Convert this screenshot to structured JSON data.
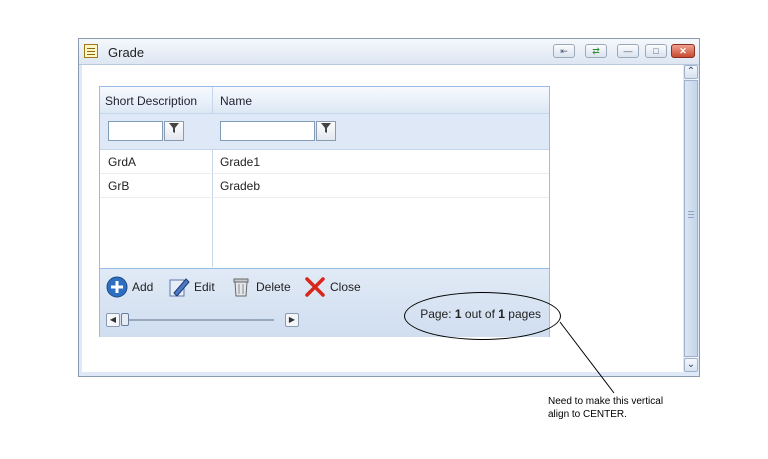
{
  "window": {
    "title": "Grade"
  },
  "grid": {
    "columns": [
      "Short Description",
      "Name"
    ],
    "rows": [
      {
        "short": "GrdA",
        "name": "Grade1"
      },
      {
        "short": "GrB",
        "name": "Gradeb"
      }
    ],
    "filter_icon": "funnel-icon"
  },
  "toolbar": {
    "add_label": "Add",
    "edit_label": "Edit",
    "delete_label": "Delete",
    "close_label": "Close"
  },
  "pager": {
    "prefix": "Page: ",
    "current": "1",
    "middle": " out of ",
    "total": "1",
    "suffix": " pages"
  },
  "annotation": {
    "line1": "Need to make this vertical",
    "line2": "align to CENTER."
  },
  "colors": {
    "grid_border": "#99bbe8",
    "toolbar_bg": "#d0def0",
    "close_red": "#d8261b",
    "add_blue": "#2f6fc2"
  }
}
